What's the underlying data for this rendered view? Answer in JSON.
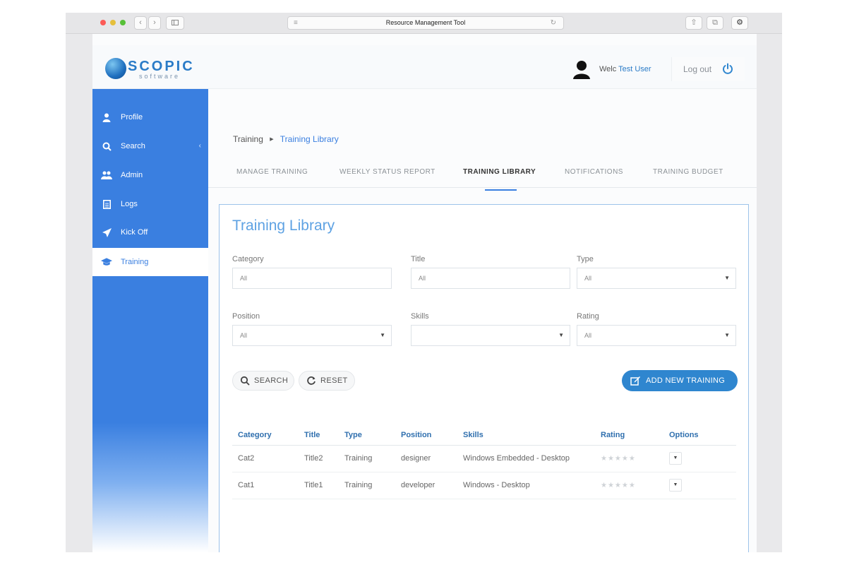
{
  "browser": {
    "title": "Resource Management Tool",
    "traffic_colors": [
      "#fc5b57",
      "#e5bf3c",
      "#57c038"
    ]
  },
  "header": {
    "logo_word": "SCOPIC",
    "logo_sub": "software",
    "welcome_prefix": "Welc",
    "user_name": "Test User",
    "logout_label": "Log out"
  },
  "sidebar": {
    "items": [
      {
        "label": "Profile",
        "icon": "user-icon"
      },
      {
        "label": "Search",
        "icon": "search-icon"
      },
      {
        "label": "Admin",
        "icon": "users-icon"
      },
      {
        "label": "Logs",
        "icon": "document-icon"
      },
      {
        "label": "Kick Off",
        "icon": "rocket-icon"
      },
      {
        "label": "Training",
        "icon": "graduation-cap-icon",
        "active": true
      }
    ]
  },
  "breadcrumb": {
    "parent": "Training",
    "current": "Training Library"
  },
  "tabs": [
    {
      "label": "MANAGE TRAINING"
    },
    {
      "label": "WEEKLY STATUS REPORT"
    },
    {
      "label": "TRAINING LIBRARY",
      "active": true
    },
    {
      "label": "NOTIFICATIONS"
    },
    {
      "label": "TRAINING BUDGET"
    }
  ],
  "panel": {
    "title": "Training Library",
    "filters": {
      "category": {
        "label": "Category",
        "value": "All"
      },
      "title": {
        "label": "Title",
        "value": "All"
      },
      "type": {
        "label": "Type",
        "value": "All"
      },
      "position": {
        "label": "Position",
        "value": "All"
      },
      "skills": {
        "label": "Skills",
        "value": ""
      },
      "rating": {
        "label": "Rating",
        "value": "All"
      }
    },
    "search_label": "SEARCH",
    "reset_label": "RESET",
    "add_label": "ADD NEW TRAINING"
  },
  "table": {
    "columns": [
      "Category",
      "Title",
      "Type",
      "Position",
      "Skills",
      "Rating",
      "Options"
    ],
    "rows": [
      {
        "category": "Cat2",
        "title": "Title2",
        "type": "Training",
        "position": "designer",
        "skills": "Windows Embedded - Desktop",
        "rating": "★★★★★"
      },
      {
        "category": "Cat1",
        "title": "Title1",
        "type": "Training",
        "position": "developer",
        "skills": "Windows - Desktop",
        "rating": "★★★★★"
      }
    ]
  },
  "colors": {
    "sidebar_blue": "#3a7fe0",
    "primary_button": "#2f86cf",
    "table_header": "#2f6fae"
  }
}
